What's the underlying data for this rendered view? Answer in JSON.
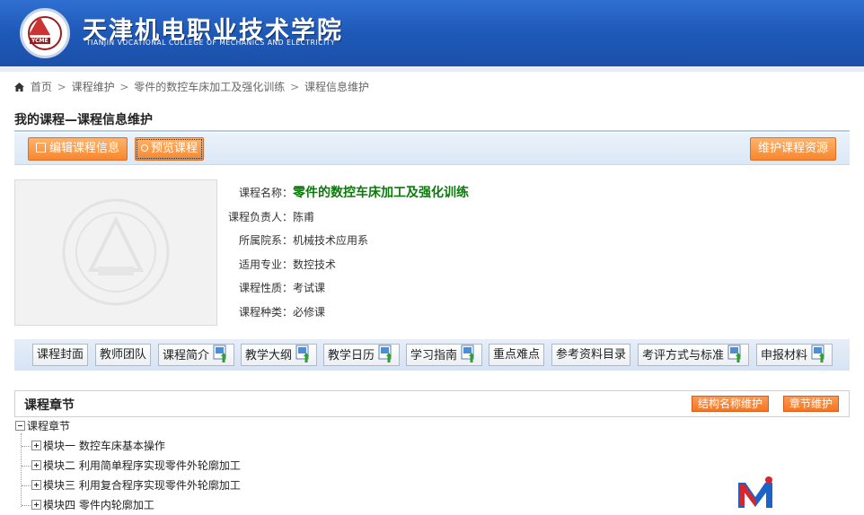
{
  "header": {
    "school_name": "天津机电职业技术学院",
    "school_name_en": "TIANJIN VOCATIONAL COLLEGE OF MECHANICS AND ELECTRICITY",
    "logo_text": "YCME"
  },
  "breadcrumb": {
    "items": [
      "首页",
      "课程维护",
      "零件的数控车床加工及强化训练",
      "课程信息维护"
    ],
    "separator": ">"
  },
  "page_title": "我的课程—课程信息维护",
  "toolbar": {
    "edit_label": "编辑课程信息",
    "preview_label": "预览课程",
    "maintain_label": "维护课程资源"
  },
  "course": {
    "name_label": "课程名称：",
    "name": "零件的数控车床加工及强化训练",
    "owner_label": "课程负责人：",
    "owner": "陈甫",
    "dept_label": "所属院系：",
    "dept": "机械技术应用系",
    "major_label": "适用专业：",
    "major": "数控技术",
    "nature_label": "课程性质：",
    "nature": "考试课",
    "kind_label": "课程种类：",
    "kind": "必修课"
  },
  "nav": [
    {
      "label": "课程封面",
      "doc": false
    },
    {
      "label": "教师团队",
      "doc": false
    },
    {
      "label": "课程简介",
      "doc": true
    },
    {
      "label": "教学大纲",
      "doc": true
    },
    {
      "label": "教学日历",
      "doc": true
    },
    {
      "label": "学习指南",
      "doc": true
    },
    {
      "label": "重点难点",
      "doc": false
    },
    {
      "label": "参考资料目录",
      "doc": false
    },
    {
      "label": "考评方式与标准",
      "doc": true
    },
    {
      "label": "申报材料",
      "doc": true
    }
  ],
  "chapters": {
    "title": "课程章节",
    "struct_btn": "结构名称维护",
    "chapter_btn": "章节维护",
    "root": "课程章节",
    "modules": [
      "模块一 数控车床基本操作",
      "模块二 利用简单程序实现零件外轮廓加工",
      "模块三 利用复合程序实现零件外轮廓加工",
      "模块四 零件内轮廓加工"
    ]
  },
  "colors": {
    "banner": "#1f59b8",
    "orange_button": "#f7872e",
    "course_name": "#0a7a0a"
  }
}
